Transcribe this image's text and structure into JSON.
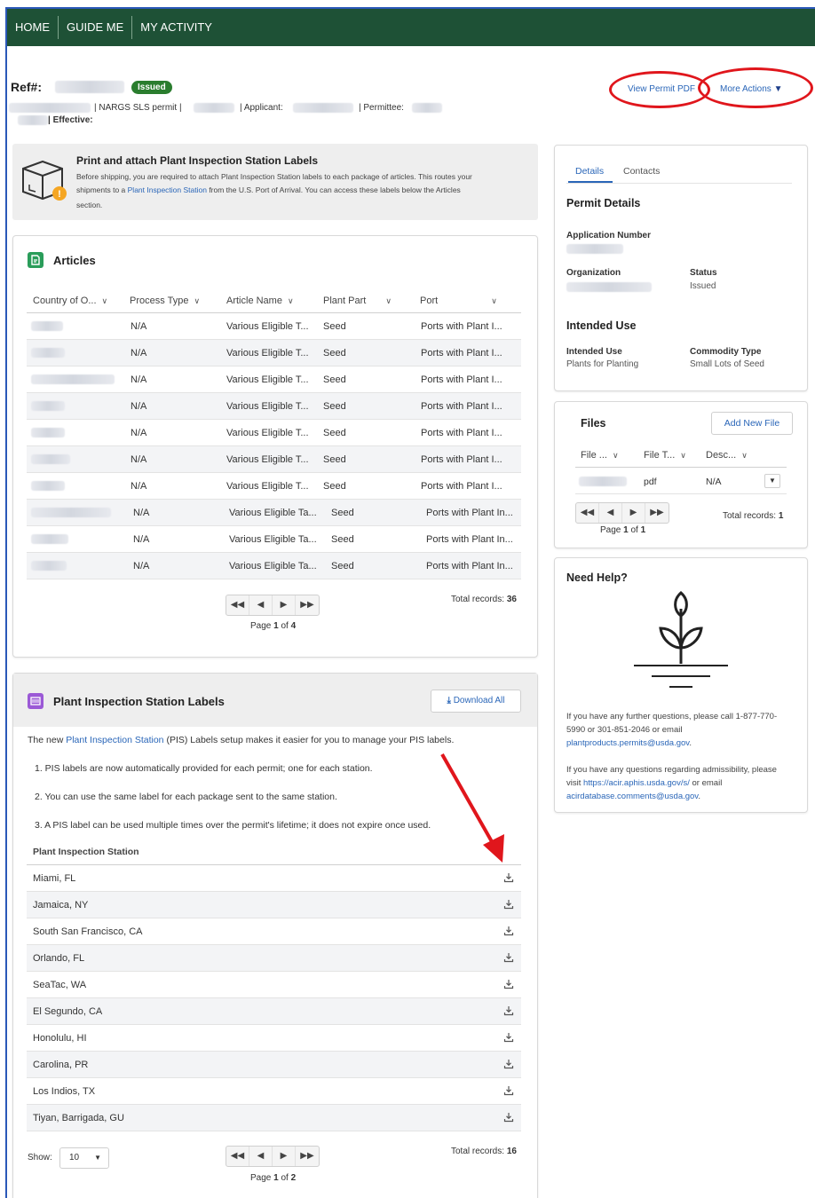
{
  "nav": [
    "HOME",
    "GUIDE ME",
    "MY ACTIVITY"
  ],
  "header": {
    "ref_label": "Ref#:",
    "status_badge": "Issued",
    "permit_type": "| NARGS SLS permit |",
    "applicant_label": "| Applicant:",
    "permittee_label": "| Permittee:",
    "effective_label": "| Effective:",
    "view_permit_pdf": "View Permit PDF",
    "more_actions": "More Actions"
  },
  "banner": {
    "title": "Print and attach Plant Inspection Station Labels",
    "text_1": "Before shipping, you are required to attach Plant Inspection Station labels to each package of articles. This routes your",
    "text_2a": "shipments to a ",
    "text_2_link": "Plant Inspection Station",
    "text_2b": " from the U.S. Port of Arrival. You can access these labels below the Articles",
    "text_3": "section."
  },
  "articles": {
    "title": "Articles",
    "columns": [
      "Country of O...",
      "Process Type",
      "Article Name",
      "Plant Part",
      "Port"
    ],
    "rows": [
      {
        "process": "N/A",
        "article": "Various Eligible T...",
        "part": "Seed",
        "port": "Ports with Plant I..."
      },
      {
        "process": "N/A",
        "article": "Various Eligible T...",
        "part": "Seed",
        "port": "Ports with Plant I..."
      },
      {
        "process": "N/A",
        "article": "Various Eligible T...",
        "part": "Seed",
        "port": "Ports with Plant I..."
      },
      {
        "process": "N/A",
        "article": "Various Eligible T...",
        "part": "Seed",
        "port": "Ports with Plant I..."
      },
      {
        "process": "N/A",
        "article": "Various Eligible T...",
        "part": "Seed",
        "port": "Ports with Plant I..."
      },
      {
        "process": "N/A",
        "article": "Various Eligible T...",
        "part": "Seed",
        "port": "Ports with Plant I..."
      },
      {
        "process": "N/A",
        "article": "Various Eligible T...",
        "part": "Seed",
        "port": "Ports with Plant I..."
      },
      {
        "process": "N/A",
        "article": "Various Eligible Ta...",
        "part": "Seed",
        "port": "Ports with Plant In..."
      },
      {
        "process": "N/A",
        "article": "Various Eligible Ta...",
        "part": "Seed",
        "port": "Ports with Plant In..."
      },
      {
        "process": "N/A",
        "article": "Various Eligible Ta...",
        "part": "Seed",
        "port": "Ports with Plant In..."
      }
    ],
    "total_label": "Total records:",
    "total": "36",
    "page_label": "Page",
    "page": "1",
    "of_label": "of",
    "pages": "4"
  },
  "pis": {
    "title": "Plant Inspection Station Labels",
    "download_all": "Download All",
    "intro_a": "The new ",
    "intro_link": "Plant Inspection Station",
    "intro_b": " (PIS) Labels setup makes it easier for you to manage your PIS labels.",
    "point_1": "1. PIS labels are now automatically provided for each permit; one for each station.",
    "point_2": "2. You can use the same label for each package sent to the same station.",
    "point_3": "3. A PIS label can be used multiple times over the permit's lifetime; it does not expire once used.",
    "column": "Plant Inspection Station",
    "stations": [
      "Miami, FL",
      "Jamaica, NY",
      "South San Francisco, CA",
      "Orlando, FL",
      "SeaTac, WA",
      "El Segundo, CA",
      "Honolulu, HI",
      "Carolina, PR",
      "Los Indios, TX",
      "Tiyan, Barrigada, GU"
    ],
    "show_label": "Show:",
    "show_value": "10",
    "total_label": "Total records:",
    "total": "16",
    "page_label": "Page",
    "page": "1",
    "of_label": "of",
    "pages": "2"
  },
  "details": {
    "tabs": [
      "Details",
      "Contacts"
    ],
    "title": "Permit Details",
    "application_number_label": "Application Number",
    "organization_label": "Organization",
    "status_label": "Status",
    "status_value": "Issued",
    "intended_use_heading": "Intended Use",
    "intended_use_label": "Intended Use",
    "intended_use_value": "Plants for Planting",
    "commodity_label": "Commodity Type",
    "commodity_value": "Small Lots of Seed"
  },
  "files": {
    "title": "Files",
    "add_new": "Add New File",
    "columns": [
      "File ...",
      "File T...",
      "Desc..."
    ],
    "row": {
      "type": "pdf",
      "desc": "N/A"
    },
    "total_label": "Total records:",
    "total": "1",
    "page_label": "Page",
    "page": "1",
    "of_label": "of",
    "pages": "1"
  },
  "help": {
    "title": "Need Help?",
    "text_1a": "If you have any further questions, please call 1-877-770-",
    "text_1b": "5990 or 301-851-2046 or email",
    "email_1": "plantproducts.permits@usda.gov",
    "text_2a": "If you have any questions regarding admissibility, please",
    "text_2b": "visit ",
    "url": "https://acir.aphis.usda.gov/s/",
    "text_2c": " or email",
    "email_2": "acirdatabase.comments@usda.gov"
  },
  "colors": {
    "nav": "#1e5136",
    "badge": "#2a7d2e",
    "link": "#2a66b8",
    "annotation": "#e0161c"
  }
}
